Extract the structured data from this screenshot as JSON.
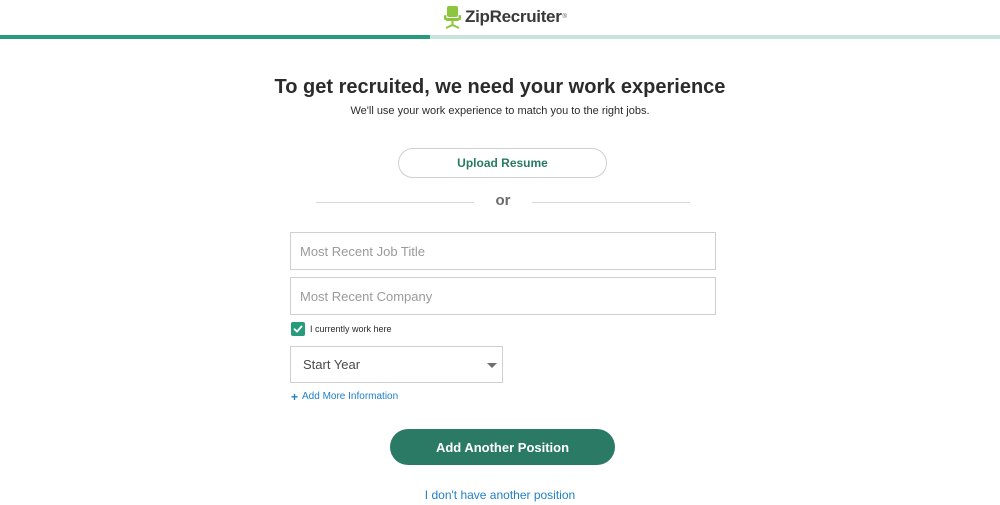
{
  "header": {
    "logo_text": "ZipRecruiter",
    "logo_reg": "®",
    "logo_icon": "office-chair-icon",
    "brand_color": "#8cc63f"
  },
  "progress": {
    "fraction": 0.43,
    "fill_color": "#279b7c"
  },
  "main": {
    "title": "To get recruited, we need your work experience",
    "subtitle": "We'll use your work experience to match you to the right jobs.",
    "upload_label": "Upload Resume",
    "divider_text": "or",
    "job_title_placeholder": "Most Recent Job Title",
    "company_placeholder": "Most Recent Company",
    "current_work_label": "I currently work here",
    "current_work_checked": true,
    "start_year_label": "Start Year",
    "add_more_label": "Add More Information",
    "add_position_label": "Add Another Position",
    "no_position_label": "I don't have another position"
  },
  "colors": {
    "accent": "#279b7c",
    "button": "#2a7a66",
    "link": "#1f7fc9"
  }
}
